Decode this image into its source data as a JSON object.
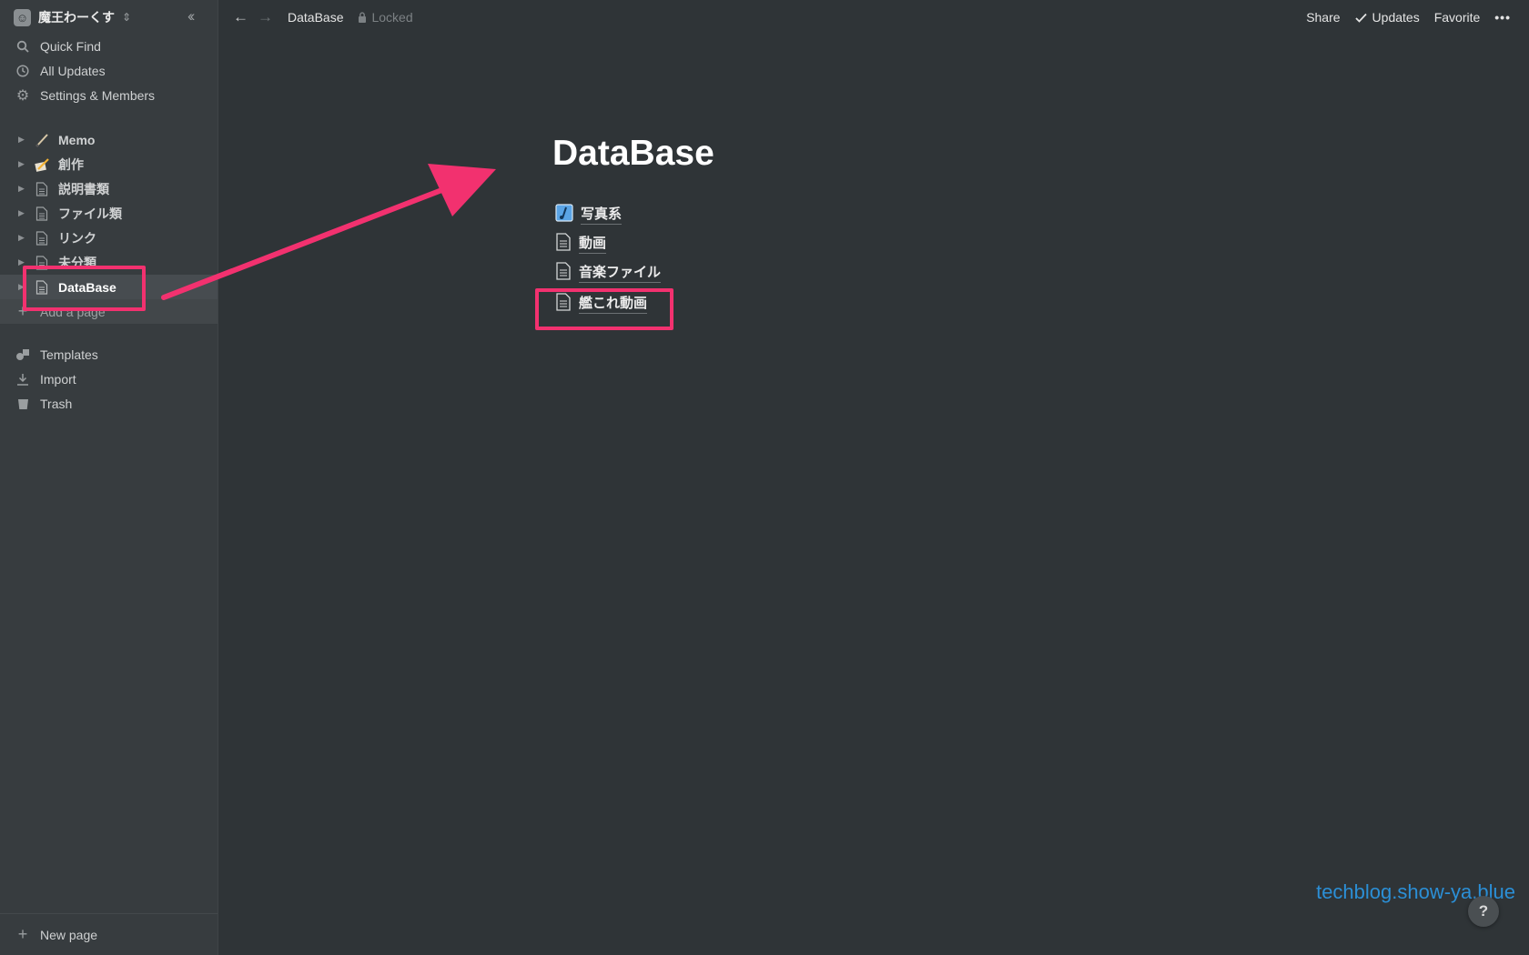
{
  "workspace": {
    "name": "魔王わーくす"
  },
  "sidebar": {
    "quick_find": "Quick Find",
    "all_updates": "All Updates",
    "settings": "Settings & Members",
    "pages": [
      {
        "label": "Memo",
        "icon": "brush-icon"
      },
      {
        "label": "創作",
        "icon": "pencil-paper-icon"
      },
      {
        "label": "説明書類",
        "icon": "page-icon"
      },
      {
        "label": "ファイル類",
        "icon": "page-icon"
      },
      {
        "label": "リンク",
        "icon": "page-icon"
      },
      {
        "label": "未分類",
        "icon": "page-icon"
      },
      {
        "label": "DataBase",
        "icon": "page-icon"
      }
    ],
    "add_page": "Add a page",
    "templates": "Templates",
    "import": "Import",
    "trash": "Trash",
    "new_page": "New page"
  },
  "topbar": {
    "breadcrumb": "DataBase",
    "locked": "Locked",
    "share": "Share",
    "updates": "Updates",
    "favorite": "Favorite",
    "more": "•••"
  },
  "page": {
    "title": "DataBase",
    "subpages": [
      {
        "label": "写真系",
        "icon": "photo-icon"
      },
      {
        "label": "動画",
        "icon": "page-icon"
      },
      {
        "label": "音楽ファイル",
        "icon": "page-icon"
      },
      {
        "label": "艦これ動画",
        "icon": "page-icon"
      }
    ]
  },
  "watermark": "techblog.show-ya.blue",
  "help": "?",
  "colors": {
    "highlight": "#f2316f",
    "background": "#2f3437",
    "sidebar": "#373c3f",
    "watermark": "#2b8fd6"
  }
}
